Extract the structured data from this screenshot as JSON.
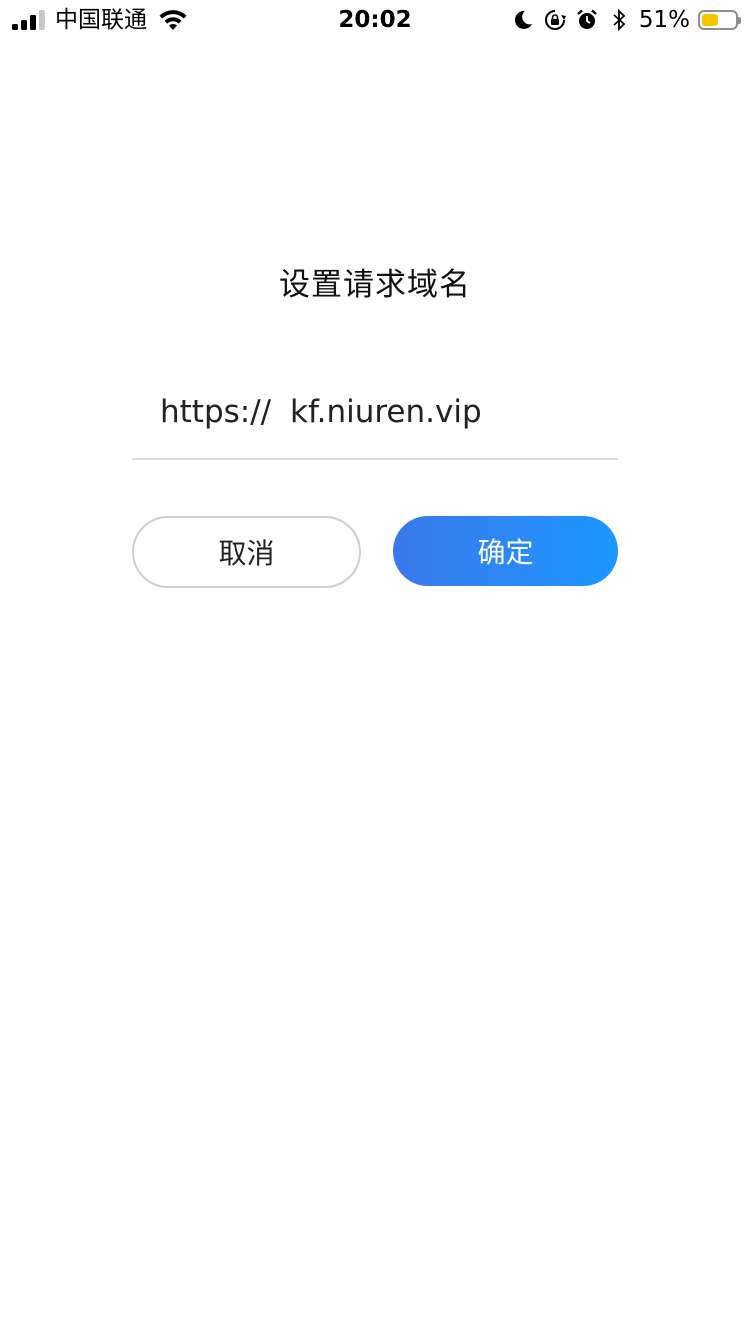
{
  "status_bar": {
    "carrier": "中国联通",
    "time": "20:02",
    "battery_percent": "51%",
    "battery_level": 0.51,
    "battery_color": "#f7c600",
    "signal_bars_active": 3,
    "icons": [
      "signal-icon",
      "wifi-icon",
      "moon-icon",
      "rotation-lock-icon",
      "alarm-icon",
      "bluetooth-icon",
      "battery-icon"
    ]
  },
  "dialog": {
    "title": "设置请求域名",
    "prefix": "https://",
    "domain_value": "kf.niuren.vip",
    "cancel_label": "取消",
    "confirm_label": "确定"
  },
  "colors": {
    "confirm_gradient_start": "#3b78ea",
    "confirm_gradient_end": "#1c97ff",
    "divider": "#dedede"
  }
}
